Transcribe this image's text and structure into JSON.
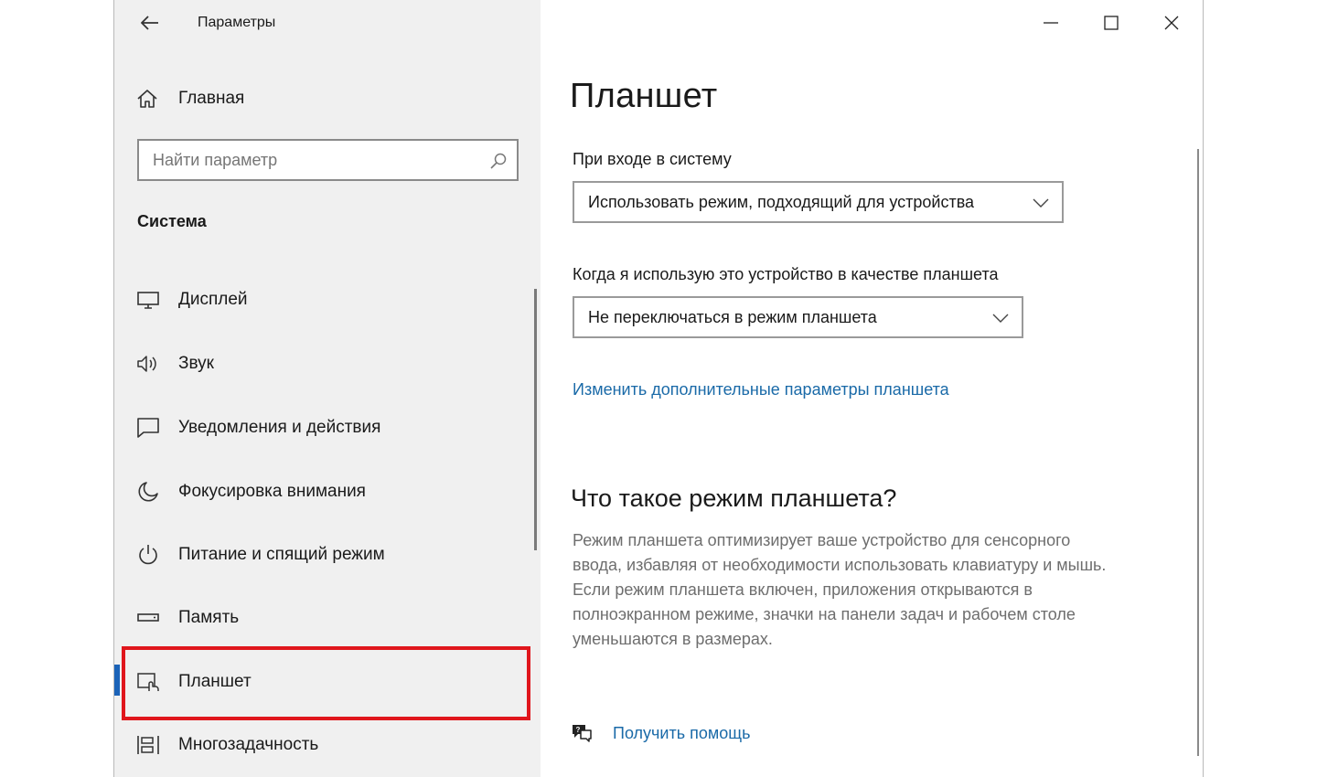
{
  "window": {
    "app_title": "Параметры",
    "controls": {
      "minimize": "minimize-icon",
      "maximize": "maximize-icon",
      "close": "close-icon"
    }
  },
  "sidebar": {
    "home_label": "Главная",
    "search_placeholder": "Найти параметр",
    "section_title": "Система",
    "items": [
      {
        "label": "Дисплей",
        "icon": "display-icon"
      },
      {
        "label": "Звук",
        "icon": "sound-icon"
      },
      {
        "label": "Уведомления и действия",
        "icon": "notifications-icon"
      },
      {
        "label": "Фокусировка внимания",
        "icon": "focus-assist-icon"
      },
      {
        "label": "Питание и спящий режим",
        "icon": "power-icon"
      },
      {
        "label": "Память",
        "icon": "storage-icon"
      },
      {
        "label": "Планшет",
        "icon": "tablet-icon",
        "selected": true
      },
      {
        "label": "Многозадачность",
        "icon": "multitasking-icon"
      }
    ]
  },
  "content": {
    "title": "Планшет",
    "signin_label": "При входе в систему",
    "signin_value": "Использовать режим, подходящий для устройства",
    "tablet_use_label": "Когда я использую это устройство в качестве планшета",
    "tablet_use_value": "Не переключаться в режим планшета",
    "additional_link": "Изменить дополнительные параметры планшета",
    "about_title": "Что такое режим планшета?",
    "about_lines": [
      "Режим планшета оптимизирует ваше устройство для сенсорного",
      "ввода, избавляя от необходимости использовать клавиатуру и мышь.",
      "Если режим планшета включен, приложения открываются в",
      "полноэкранном режиме, значки на панели задач и рабочем столе",
      "уменьшаются в размерах."
    ],
    "help_link": "Получить помощь"
  },
  "colors": {
    "accent": "#1b63b8",
    "link": "#1a6aa8",
    "highlight": "#e0161c"
  }
}
